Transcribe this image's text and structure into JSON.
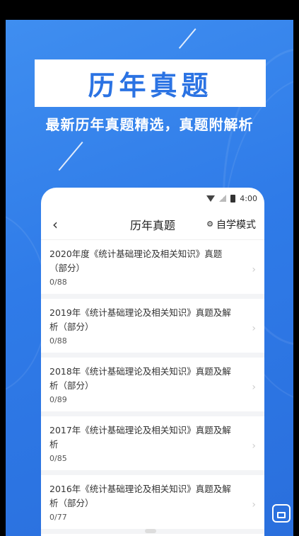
{
  "poster": {
    "headline": "历年真题",
    "subtitle": "最新历年真题精选，真题附解析"
  },
  "status_bar": {
    "time": "4:00"
  },
  "navbar": {
    "back_icon": "‹",
    "title": "历年真题",
    "mode_label": "自学模式"
  },
  "items": [
    {
      "title": "2020年度《统计基础理论及相关知识》真题（部分）",
      "count": "0/88"
    },
    {
      "title": "2019年《统计基础理论及相关知识》真题及解析（部分）",
      "count": "0/88"
    },
    {
      "title": "2018年《统计基础理论及相关知识》真题及解析（部分）",
      "count": "0/89"
    },
    {
      "title": "2017年《统计基础理论及相关知识》真题及解析",
      "count": "0/85"
    },
    {
      "title": "2016年《统计基础理论及相关知识》真题及解析（部分）",
      "count": "0/77"
    }
  ],
  "colors": {
    "brand_blue": "#2b73e3",
    "background_blue": "#3f8ef0"
  }
}
